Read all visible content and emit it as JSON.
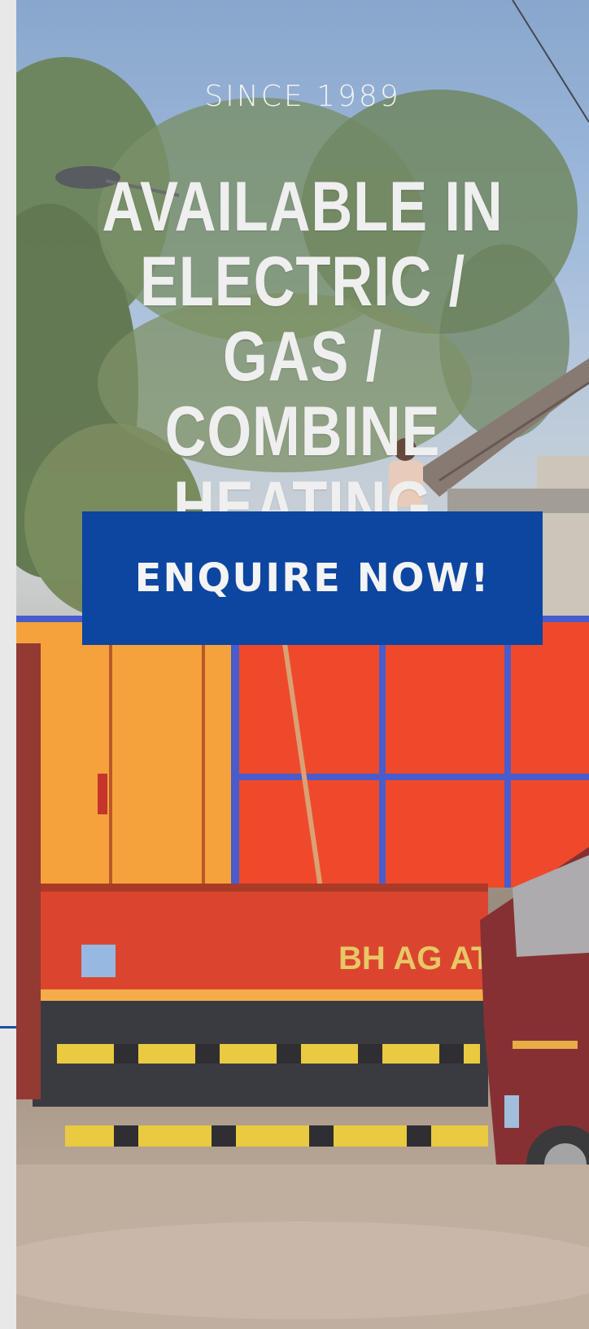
{
  "hero": {
    "tagline": "SINCE 1989",
    "headline": "AVAILABLE IN ELECTRIC / GAS / COMBINE HEATING MODES",
    "cta_label": "ENQUIRE NOW!",
    "truck_text": "BH AG AT"
  },
  "colors": {
    "cta_background": "#0c46a0",
    "accent_line": "#1d4f9e",
    "text": "#efefef"
  }
}
